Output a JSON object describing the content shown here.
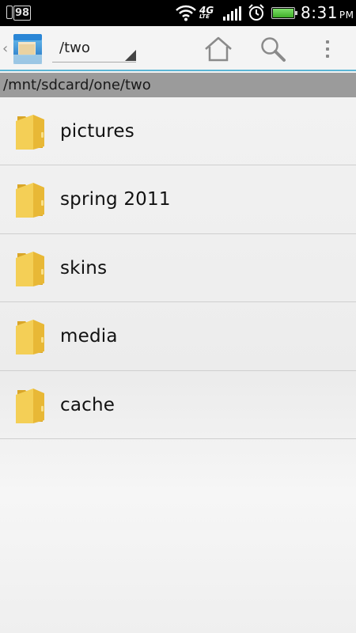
{
  "status_bar": {
    "notification_count": "98",
    "network_label": "4G",
    "network_sub": "LTE",
    "time": "8:31",
    "ampm": "PM"
  },
  "action_bar": {
    "current_folder": "/two"
  },
  "breadcrumb": {
    "path": "/mnt/sdcard/one/two"
  },
  "files": [
    {
      "name": "pictures",
      "icon": "folder-icon"
    },
    {
      "name": "spring 2011",
      "icon": "folder-icon"
    },
    {
      "name": "skins",
      "icon": "folder-icon"
    },
    {
      "name": "media",
      "icon": "folder-icon"
    },
    {
      "name": "cache",
      "icon": "folder-icon"
    }
  ],
  "colors": {
    "accent_line": "#5bb6d6",
    "breadcrumb_bg": "#9b9b9b",
    "folder": "#f2c94c"
  }
}
